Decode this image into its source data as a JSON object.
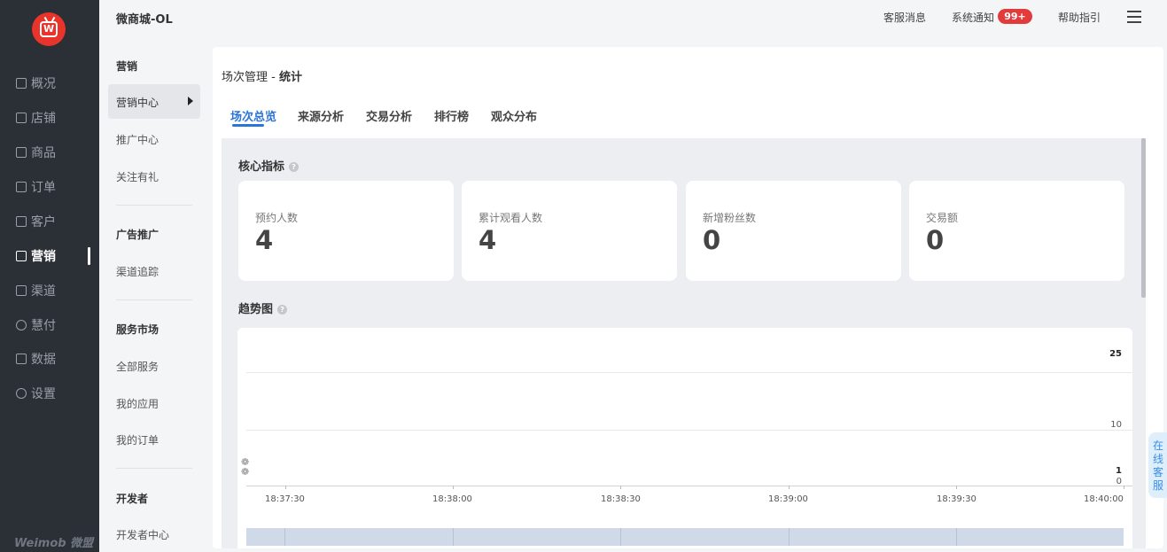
{
  "nav": {
    "items": [
      {
        "label": "概况",
        "icon": "overview-icon"
      },
      {
        "label": "店铺",
        "icon": "store-icon"
      },
      {
        "label": "商品",
        "icon": "goods-icon"
      },
      {
        "label": "订单",
        "icon": "order-icon"
      },
      {
        "label": "客户",
        "icon": "customer-icon"
      },
      {
        "label": "营销",
        "icon": "marketing-icon"
      },
      {
        "label": "渠道",
        "icon": "channel-icon"
      },
      {
        "label": "慧付",
        "icon": "pay-icon"
      },
      {
        "label": "数据",
        "icon": "data-icon"
      },
      {
        "label": "设置",
        "icon": "settings-icon"
      }
    ],
    "brand": "Weimob 微盟"
  },
  "app_title": "微商城-OL",
  "subnav": {
    "section1": "营销",
    "active_item": "营销中心",
    "items1": [
      "推广中心",
      "关注有礼"
    ],
    "section2": "广告推广",
    "items2": [
      "渠道追踪"
    ],
    "section3": "服务市场",
    "items3": [
      "全部服务",
      "我的应用",
      "我的订单"
    ],
    "section4": "开发者",
    "items4": [
      "开发者中心"
    ]
  },
  "topbar": {
    "service_msg": "客服消息",
    "system_notice": "系统通知",
    "notice_count": "99+",
    "help": "帮助指引"
  },
  "breadcrumb": {
    "prefix": "场次管理 - ",
    "current": "统计"
  },
  "tabs": [
    "场次总览",
    "来源分析",
    "交易分析",
    "排行榜",
    "观众分布"
  ],
  "core_title": "核心指标",
  "metrics": [
    {
      "label": "预约人数",
      "value": "4"
    },
    {
      "label": "累计观看人数",
      "value": "4"
    },
    {
      "label": "新增粉丝数",
      "value": "0"
    },
    {
      "label": "交易额",
      "value": "0"
    }
  ],
  "trend_title": "趋势图",
  "chart_data": {
    "type": "line",
    "title": "趋势图",
    "x": [
      "18:37:30",
      "18:38:00",
      "18:38:30",
      "18:39:00",
      "18:39:30",
      "18:40:00"
    ],
    "y_ticks_right": [
      "25",
      "10",
      "1",
      "0"
    ],
    "series": []
  },
  "online_service": "在线客服",
  "colors": {
    "accent": "#2b74d8",
    "badge": "#e23b3b",
    "nav_bg": "#2b2f36"
  }
}
